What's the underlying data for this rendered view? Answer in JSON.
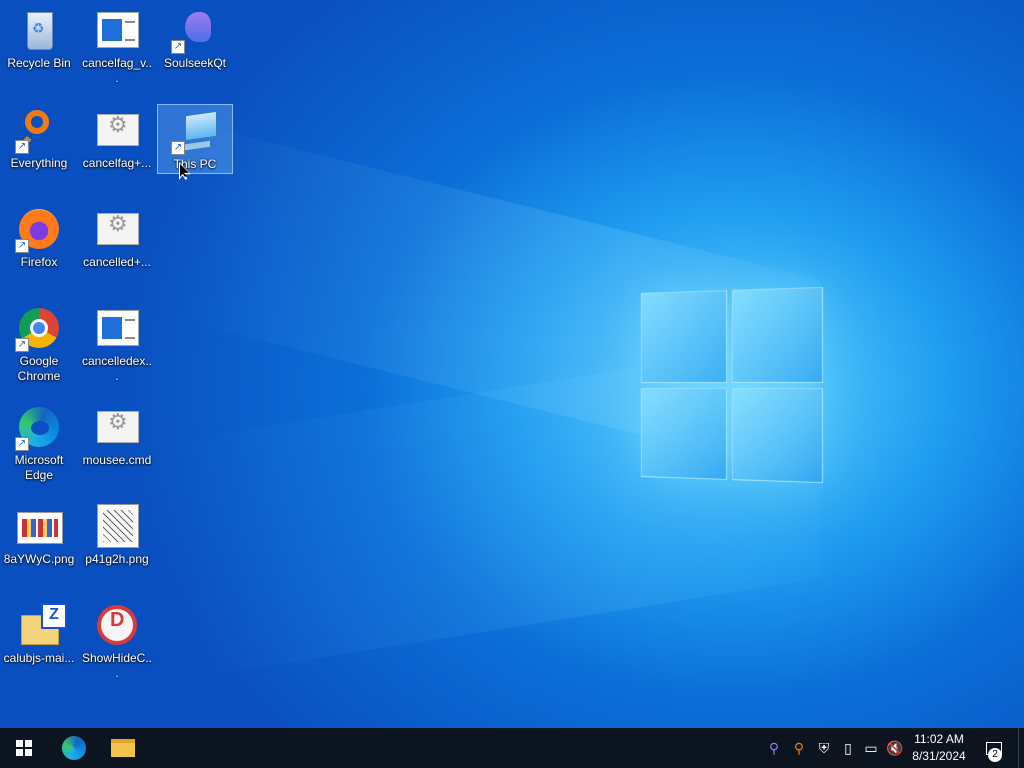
{
  "desktop": {
    "icons": [
      {
        "label": "Recycle Bin",
        "icon": "recycle-bin-icon"
      },
      {
        "label": "cancelfag_v...",
        "icon": "document-icon"
      },
      {
        "label": "SoulseekQt",
        "icon": "soulseek-icon"
      },
      {
        "label": "Everything",
        "icon": "everything-search-icon"
      },
      {
        "label": "cancelfag+...",
        "icon": "batch-file-icon"
      },
      {
        "label": "This PC",
        "icon": "this-pc-icon"
      },
      {
        "label": "Firefox",
        "icon": "firefox-icon"
      },
      {
        "label": "cancelled+...",
        "icon": "batch-file-icon"
      },
      {
        "label": "Google Chrome",
        "icon": "chrome-icon"
      },
      {
        "label": "cancelledex...",
        "icon": "document-icon"
      },
      {
        "label": "Microsoft Edge",
        "icon": "edge-icon"
      },
      {
        "label": "mousee.cmd",
        "icon": "batch-file-icon"
      },
      {
        "label": "8aYWyC.png",
        "icon": "image-file-icon"
      },
      {
        "label": "p41g2h.png",
        "icon": "image-file-icon"
      },
      {
        "label": "calubjs-mai...",
        "icon": "zip-folder-icon"
      },
      {
        "label": "ShowHideC...",
        "icon": "showhide-icon"
      }
    ],
    "selected": "This PC"
  },
  "taskbar": {
    "pinned": [
      {
        "name": "start",
        "icon": "windows-start-icon"
      },
      {
        "name": "edge",
        "icon": "edge-icon"
      },
      {
        "name": "file-explorer",
        "icon": "folder-icon"
      }
    ],
    "tray_icons": [
      "soulseek-tray-icon",
      "everything-tray-icon",
      "security-shield-icon",
      "usb-device-icon",
      "network-icon",
      "volume-muted-icon"
    ],
    "time": "11:02 AM",
    "date": "8/31/2024",
    "notification_count": "2"
  },
  "colors": {
    "taskbar_bg": "#0c1420",
    "wallpaper_primary": "#0b6fd8",
    "wallpaper_glow": "#5fd3ff"
  }
}
